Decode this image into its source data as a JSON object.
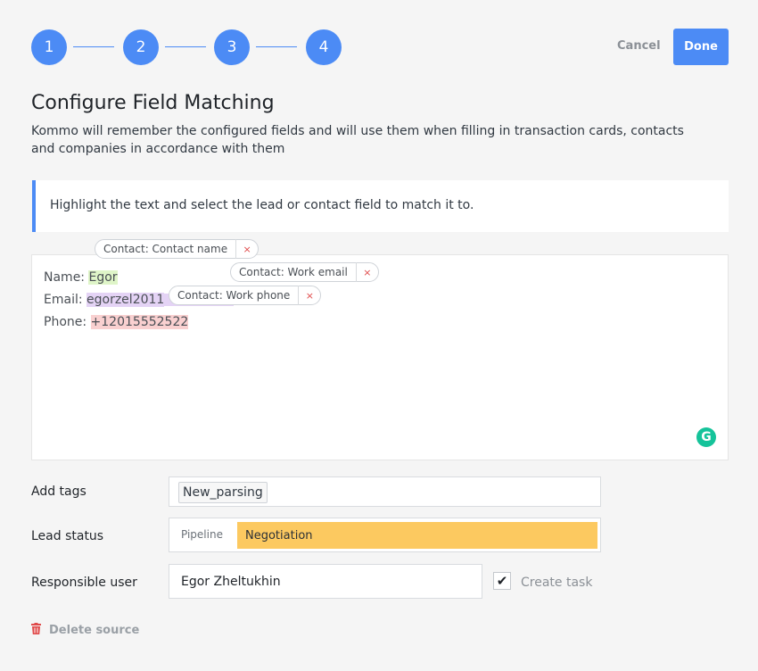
{
  "stepper": {
    "steps": [
      "1",
      "2",
      "3",
      "4"
    ],
    "accent_color": "#4c8bf5"
  },
  "actions": {
    "cancel_label": "Cancel",
    "done_label": "Done"
  },
  "header": {
    "title": "Configure Field Matching",
    "description": "Kommo  will remember the configured fields and will use them when filling in transaction cards, contacts and companies in accordance with them"
  },
  "hint": {
    "text": "Highlight the text and select the lead or contact field to match it to."
  },
  "editor": {
    "lines": [
      {
        "label": "Name: ",
        "value": "Egor"
      },
      {
        "label": "Email: ",
        "value": "egorzel2011"
      },
      {
        "label": "Phone: ",
        "value": "+12015552522"
      }
    ],
    "tooltips": [
      {
        "text": "Contact: Contact name",
        "close": "×"
      },
      {
        "text": "Contact: Work email",
        "close": "×"
      },
      {
        "text": "Contact: Work phone",
        "close": "×"
      }
    ],
    "grammarly_icon": "grammarly-icon"
  },
  "form": {
    "tags_label": "Add tags",
    "tag_value": "New_parsing",
    "status_label": "Lead status",
    "pipeline_label": "Pipeline",
    "status_value": "Negotiation",
    "status_color": "#fcc960",
    "user_label": "Responsible user",
    "user_value": "Egor Zheltukhin",
    "create_task_label": "Create task",
    "create_task_checked": true
  },
  "footer": {
    "delete_label": "Delete source",
    "delete_icon": "trash-icon"
  }
}
